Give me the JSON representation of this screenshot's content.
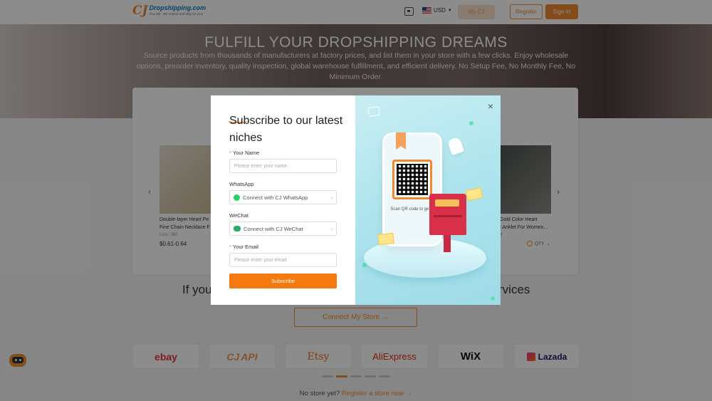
{
  "header": {
    "brand": "Dropshipping.com",
    "tagline": "You sell - We source and ship for you!",
    "currency": "USD",
    "my_cj": "My CJ",
    "register": "Register",
    "sign_in": "Sign In"
  },
  "hero": {
    "title": "FULFILL YOUR DROPSHIPPING DREAMS",
    "subtitle": "Source products from thousands of manufacturers at factory prices, and list them in your store with a few clicks. Enjoy wholesale options, preorder inventory, quality inspection, global warehouse fulfillment, and efficient delivery. No Setup Fee, No Monthly Fee, No Minimum Order."
  },
  "products": {
    "left": {
      "name_line1": "Double-layer Heart Pe",
      "name_line2": "Fine Chain Necklace F",
      "meta": "Lists: 380",
      "price": "$0.61-0.64"
    },
    "right": {
      "name_line1": "Gold Color Heart",
      "name_line2": "t Anklet For Women...",
      "meta": "4",
      "qty": "QTY"
    }
  },
  "connect_section": {
    "heading_left": "If you",
    "heading_right": "rvices",
    "connect_button": "Connect My Store →"
  },
  "platforms": [
    "ebay",
    "API",
    "Etsy",
    "AliExpress",
    "WiX",
    "Lazada"
  ],
  "no_store": {
    "text": "No store yet?",
    "link": "Register a store now →"
  },
  "modal": {
    "title": "Subscribe to our latest niches",
    "name_label": "Your Name",
    "name_placeholder": "Please enter your name",
    "whatsapp_label": "WhatsApp",
    "whatsapp_connect": "Connect with CJ WhatsApp",
    "wechat_label": "WeChat",
    "wechat_connect": "Connect with CJ WeChat",
    "email_label": "Your Email",
    "email_placeholder": "Please enter your email",
    "subscribe_button": "Subscribe",
    "scan_text": "Scan QR code to get the app.",
    "close_symbol": "×",
    "required_mark": "*",
    "chevron": "›"
  },
  "colors": {
    "accent": "#f08a2e",
    "overlay": "rgba(0,0,0,0.45)"
  }
}
